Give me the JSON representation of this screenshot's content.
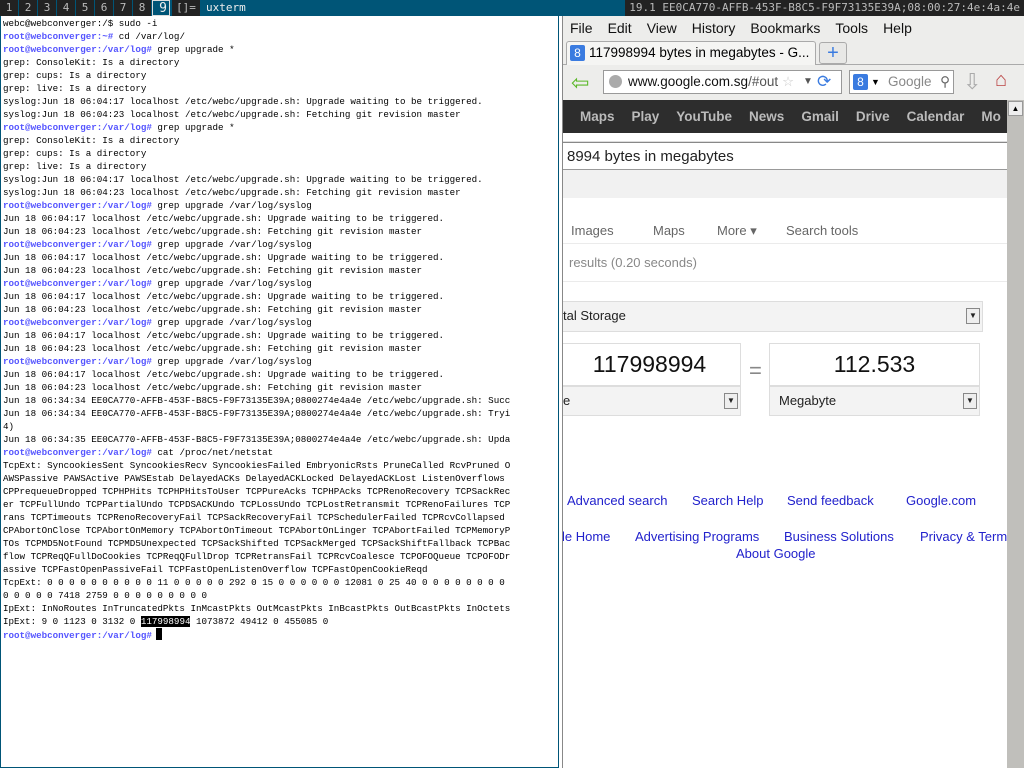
{
  "topbar": {
    "tags": [
      "1",
      "2",
      "3",
      "4",
      "5",
      "6",
      "7",
      "8",
      "9"
    ],
    "selected_tag": "9",
    "layout": "[]=",
    "window_title": "uxterm",
    "status": "19.1 EE0CA770-AFFB-453F-B8C5-F9F73135E39A;08:00:27:4e:4a:4e"
  },
  "terminal": {
    "lines": [
      {
        "prompt": "",
        "text": "webc@webconverger:/$ sudo -i"
      },
      {
        "prompt": "root@webconverger:~#",
        "text": " cd /var/log/"
      },
      {
        "prompt": "root@webconverger:/var/log#",
        "text": " grep upgrade *"
      },
      {
        "prompt": "",
        "text": "grep: ConsoleKit: Is a directory"
      },
      {
        "prompt": "",
        "text": "grep: cups: Is a directory"
      },
      {
        "prompt": "",
        "text": "grep: live: Is a directory"
      },
      {
        "prompt": "",
        "text": "syslog:Jun 18 06:04:17 localhost /etc/webc/upgrade.sh: Upgrade waiting to be triggered."
      },
      {
        "prompt": "",
        "text": "syslog:Jun 18 06:04:23 localhost /etc/webc/upgrade.sh: Fetching git revision master"
      },
      {
        "prompt": "root@webconverger:/var/log#",
        "text": " grep upgrade *"
      },
      {
        "prompt": "",
        "text": "grep: ConsoleKit: Is a directory"
      },
      {
        "prompt": "",
        "text": "grep: cups: Is a directory"
      },
      {
        "prompt": "",
        "text": "grep: live: Is a directory"
      },
      {
        "prompt": "",
        "text": "syslog:Jun 18 06:04:17 localhost /etc/webc/upgrade.sh: Upgrade waiting to be triggered."
      },
      {
        "prompt": "",
        "text": "syslog:Jun 18 06:04:23 localhost /etc/webc/upgrade.sh: Fetching git revision master"
      },
      {
        "prompt": "root@webconverger:/var/log#",
        "text": " grep upgrade /var/log/syslog"
      },
      {
        "prompt": "",
        "text": "Jun 18 06:04:17 localhost /etc/webc/upgrade.sh: Upgrade waiting to be triggered."
      },
      {
        "prompt": "",
        "text": "Jun 18 06:04:23 localhost /etc/webc/upgrade.sh: Fetching git revision master"
      },
      {
        "prompt": "root@webconverger:/var/log#",
        "text": " grep upgrade /var/log/syslog"
      },
      {
        "prompt": "",
        "text": "Jun 18 06:04:17 localhost /etc/webc/upgrade.sh: Upgrade waiting to be triggered."
      },
      {
        "prompt": "",
        "text": "Jun 18 06:04:23 localhost /etc/webc/upgrade.sh: Fetching git revision master"
      },
      {
        "prompt": "root@webconverger:/var/log#",
        "text": " grep upgrade /var/log/syslog"
      },
      {
        "prompt": "",
        "text": "Jun 18 06:04:17 localhost /etc/webc/upgrade.sh: Upgrade waiting to be triggered."
      },
      {
        "prompt": "",
        "text": "Jun 18 06:04:23 localhost /etc/webc/upgrade.sh: Fetching git revision master"
      },
      {
        "prompt": "root@webconverger:/var/log#",
        "text": " grep upgrade /var/log/syslog"
      },
      {
        "prompt": "",
        "text": "Jun 18 06:04:17 localhost /etc/webc/upgrade.sh: Upgrade waiting to be triggered."
      },
      {
        "prompt": "",
        "text": "Jun 18 06:04:23 localhost /etc/webc/upgrade.sh: Fetching git revision master"
      },
      {
        "prompt": "root@webconverger:/var/log#",
        "text": " grep upgrade /var/log/syslog"
      },
      {
        "prompt": "",
        "text": "Jun 18 06:04:17 localhost /etc/webc/upgrade.sh: Upgrade waiting to be triggered."
      },
      {
        "prompt": "",
        "text": "Jun 18 06:04:23 localhost /etc/webc/upgrade.sh: Fetching git revision master"
      },
      {
        "prompt": "",
        "text": "Jun 18 06:34:34 EE0CA770-AFFB-453F-B8C5-F9F73135E39A;0800274e4a4e /etc/webc/upgrade.sh: Succ"
      },
      {
        "prompt": "",
        "text": "Jun 18 06:34:34 EE0CA770-AFFB-453F-B8C5-F9F73135E39A;0800274e4a4e /etc/webc/upgrade.sh: Tryi"
      },
      {
        "prompt": "",
        "text": "4)"
      },
      {
        "prompt": "",
        "text": "Jun 18 06:34:35 EE0CA770-AFFB-453F-B8C5-F9F73135E39A;0800274e4a4e /etc/webc/upgrade.sh: Upda"
      },
      {
        "prompt": "root@webconverger:/var/log#",
        "text": " cat /proc/net/netstat"
      },
      {
        "prompt": "",
        "text": "TcpExt: SyncookiesSent SyncookiesRecv SyncookiesFailed EmbryonicRsts PruneCalled RcvPruned O"
      },
      {
        "prompt": "",
        "text": "AWSPassive PAWSActive PAWSEstab DelayedACKs DelayedACKLocked DelayedACKLost ListenOverflows"
      },
      {
        "prompt": "",
        "text": "CPPrequeueDropped TCPHPHits TCPHPHitsToUser TCPPureAcks TCPHPAcks TCPRenoRecovery TCPSackRec"
      },
      {
        "prompt": "",
        "text": "er TCPFullUndo TCPPartialUndo TCPDSACKUndo TCPLossUndo TCPLostRetransmit TCPRenoFailures TCP"
      },
      {
        "prompt": "",
        "text": "rans TCPTimeouts TCPRenoRecoveryFail TCPSackRecoveryFail TCPSchedulerFailed TCPRcvCollapsed"
      },
      {
        "prompt": "",
        "text": "CPAbortOnClose TCPAbortOnMemory TCPAbortOnTimeout TCPAbortOnLinger TCPAbortFailed TCPMemoryP"
      },
      {
        "prompt": "",
        "text": "TOs TCPMD5NotFound TCPMD5Unexpected TCPSackShifted TCPSackMerged TCPSackShiftFallback TCPBac"
      },
      {
        "prompt": "",
        "text": "flow TCPReqQFullDoCookies TCPReqQFullDrop TCPRetransFail TCPRcvCoalesce TCPOFOQueue TCPOFODr"
      },
      {
        "prompt": "",
        "text": "assive TCPFastOpenPassiveFail TCPFastOpenListenOverflow TCPFastOpenCookieReqd"
      },
      {
        "prompt": "",
        "text": "TcpExt: 0 0 0 0 0 0 0 0 0 0 11 0 0 0 0 0 292 0 15 0 0 0 0 0 0 12081 0 25 40 0 0 0 0 0 0 0 0"
      },
      {
        "prompt": "",
        "text": "0 0 0 0 0 7418 2759 0 0 0 0 0 0 0 0 0"
      },
      {
        "prompt": "",
        "text": "IpExt: InNoRoutes InTruncatedPkts InMcastPkts OutMcastPkts InBcastPkts OutBcastPkts InOctets"
      }
    ],
    "ipext_values_before": "IpExt: 9 0 1123 0 3132 0 ",
    "ipext_selected": "117998994",
    "ipext_values_after": " 1073872 49412 0 455085 0",
    "final_prompt": "root@webconverger:/var/log#"
  },
  "browser": {
    "menu": [
      "File",
      "Edit",
      "View",
      "History",
      "Bookmarks",
      "Tools",
      "Help"
    ],
    "tab_title": "117998994 bytes in megabytes - G...",
    "new_tab": "+",
    "url_domain": "www.google.com.sg",
    "url_rest": "/#out",
    "search_placeholder": "Google",
    "google_bar": [
      "Maps",
      "Play",
      "YouTube",
      "News",
      "Gmail",
      "Drive",
      "Calendar",
      "Mo"
    ],
    "query": "8994 bytes in megabytes",
    "search_tabs": [
      "Images",
      "Maps",
      "More ▾",
      "Search tools"
    ],
    "results_stats": "results (0.20 seconds)",
    "converter": {
      "category": "tal Storage",
      "from_value": "117998994",
      "from_unit": "e",
      "equals": "=",
      "to_value": "112.533",
      "to_unit": "Megabyte"
    },
    "footer_links_1": [
      "Advanced search",
      "Search Help",
      "Send feedback",
      "Google.com"
    ],
    "footer_links_2": [
      "le Home",
      "Advertising Programs",
      "Business Solutions",
      "Privacy & Term"
    ],
    "about": "About Google"
  }
}
